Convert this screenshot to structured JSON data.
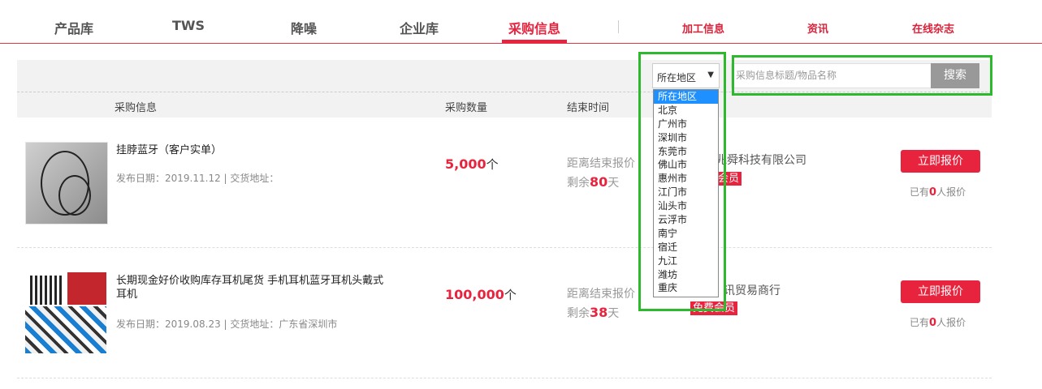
{
  "nav": {
    "items": [
      "产品库",
      "TWS",
      "降噪",
      "企业库",
      "采购信息"
    ],
    "active": "采购信息",
    "secondary": [
      "加工信息",
      "资讯",
      "在线杂志"
    ]
  },
  "filter": {
    "region_selected": "所在地区",
    "region_options": [
      "所在地区",
      "北京",
      "广州市",
      "深圳市",
      "东莞市",
      "佛山市",
      "惠州市",
      "江门市",
      "汕头市",
      "云浮市",
      "南宁",
      "宿迁",
      "九江",
      "潍坊",
      "重庆"
    ],
    "search_placeholder": "采购信息标题/物品名称",
    "search_button": "搜索"
  },
  "columns": {
    "info": "采购信息",
    "qty": "采购数量",
    "end": "结束时间"
  },
  "rows": [
    {
      "title": "挂脖蓝牙（客户实单）",
      "meta": "发布日期：2019.11.12 | 交货地址：",
      "qty": "5,000",
      "unit": "个",
      "end_label": "距离结束报价",
      "remain_prefix": "剩余",
      "remain_days": "80",
      "remain_suffix": "天",
      "company": "兆舜科技有限公司",
      "badge": "会员",
      "quote_button": "立即报价",
      "quote_prefix": "已有",
      "quote_count": "0",
      "quote_suffix": "人报价"
    },
    {
      "title": "长期现金好价收购库存耳机尾货 手机耳机蓝牙耳机头戴式耳机",
      "meta": "发布日期：2019.08.23 | 交货地址：广东省深圳市",
      "qty": "100,000",
      "unit": "个",
      "end_label": "距离结束报价",
      "remain_prefix": "剩余",
      "remain_days": "38",
      "remain_suffix": "天",
      "company": "讯贸易商行",
      "badge": "免费会员",
      "quote_button": "立即报价",
      "quote_prefix": "已有",
      "quote_count": "0",
      "quote_suffix": "人报价"
    }
  ],
  "colors": {
    "accent": "#e8233e",
    "annotation": "#2db82d",
    "dropdown_highlight": "#1e90ff"
  }
}
